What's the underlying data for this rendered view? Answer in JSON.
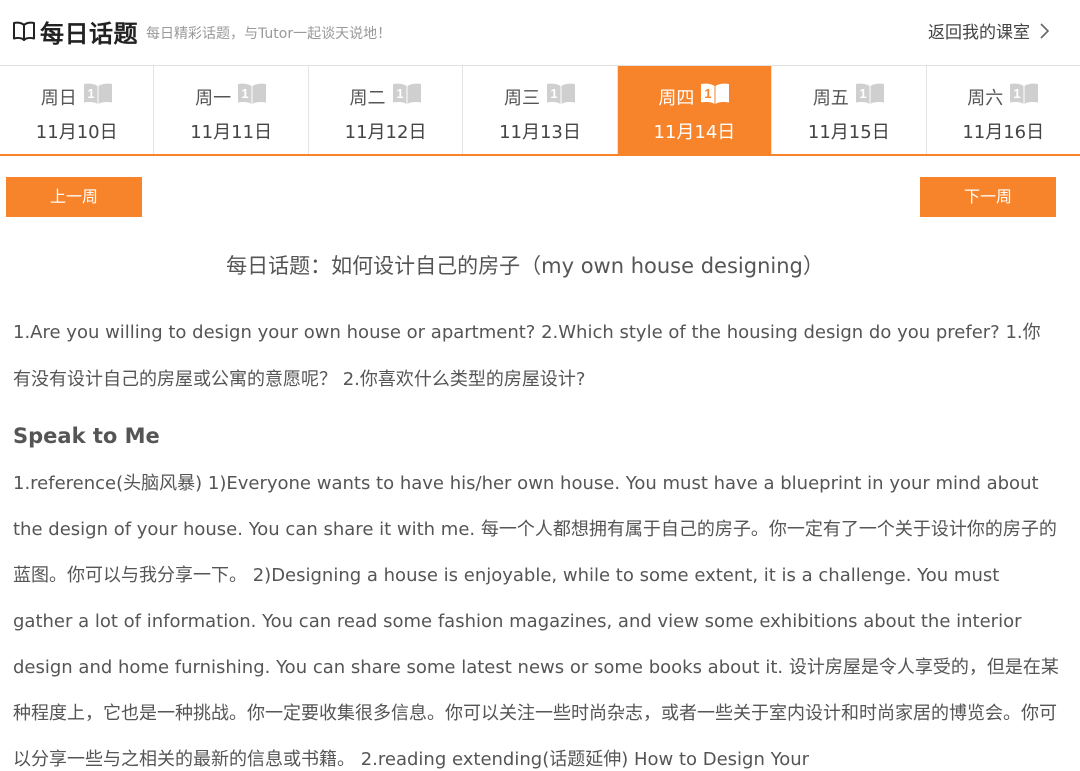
{
  "header": {
    "title": "每日话题",
    "subtitle": "每日精彩话题，与Tutor一起谈天说地！",
    "back_label": "返回我的课室"
  },
  "days": [
    {
      "weekday": "周日",
      "badge": "1",
      "date": "11月10日",
      "active": false
    },
    {
      "weekday": "周一",
      "badge": "1",
      "date": "11月11日",
      "active": false
    },
    {
      "weekday": "周二",
      "badge": "1",
      "date": "11月12日",
      "active": false
    },
    {
      "weekday": "周三",
      "badge": "1",
      "date": "11月13日",
      "active": false
    },
    {
      "weekday": "周四",
      "badge": "1",
      "date": "11月14日",
      "active": true
    },
    {
      "weekday": "周五",
      "badge": "1",
      "date": "11月15日",
      "active": false
    },
    {
      "weekday": "周六",
      "badge": "1",
      "date": "11月16日",
      "active": false
    }
  ],
  "nav": {
    "prev_week": "上一周",
    "next_week": "下一周"
  },
  "topic": {
    "title": "每日话题：如何设计自己的房子（my own house designing）",
    "questions": "1.Are you willing to design your own house or apartment? 2.Which style of the housing design do you prefer? 1.你有没有设计自己的房屋或公寓的意愿呢？ 2.你喜欢什么类型的房屋设计?",
    "section_heading": "Speak to Me",
    "body": "1.reference(头脑风暴) 1)Everyone wants to have his/her own house. You must have a blueprint in your mind about the design of your house. You can share it with me. 每一个人都想拥有属于自己的房子。你一定有了一个关于设计你的房子的蓝图。你可以与我分享一下。 2)Designing a house is enjoyable, while to some extent, it is a challenge. You must gather a lot of information. You can read some fashion magazines, and view some exhibitions about the interior design and home furnishing. You can share some latest news or some books about it. 设计房屋是令人享受的，但是在某种程度上，它也是一种挑战。你一定要收集很多信息。你可以关注一些时尚杂志，或者一些关于室内设计和时尚家居的博览会。你可以分享一些与之相关的最新的信息或书籍。 2.reading extending(话题延伸) How to Design Your"
  },
  "colors": {
    "accent": "#f7832a",
    "text": "#555555",
    "book_icon_inactive": "#cfcfcf"
  },
  "icons": {
    "logo": "open-book-icon",
    "back": "chevron-right-icon",
    "day_badge": "book-badge-icon"
  }
}
